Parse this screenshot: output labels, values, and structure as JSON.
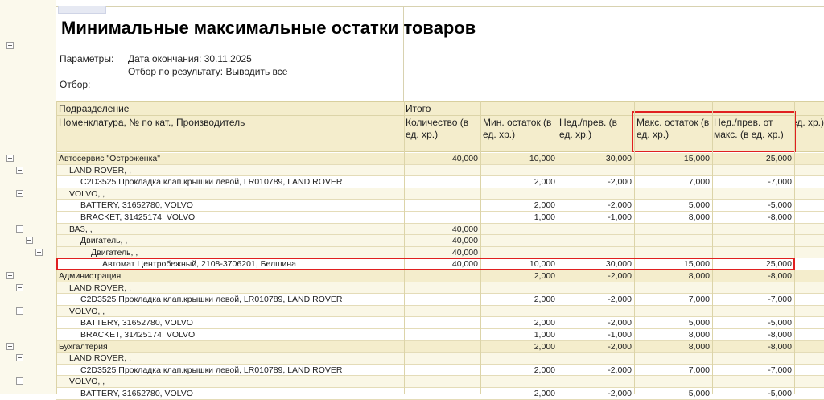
{
  "report": {
    "title": "Минимальные максимальные остатки товаров",
    "params_label": "Параметры:",
    "param1": "Дата окончания: 30.11.2025",
    "param2": "Отбор по результату: Выводить все",
    "filter_label": "Отбор:"
  },
  "header": {
    "group": "Подразделение",
    "item": "Номенклатура, № по кат., Производитель",
    "total": "Итого",
    "columns": [
      "Количество (в ед. хр.)",
      "Мин. остаток (в ед. хр.)",
      "Нед./прев. (в ед. хр.)",
      "Макс. остаток (в ед. хр.)",
      "Нед./прев. от макс. (в ед. хр.)",
      "Резерв (в ед. хр.)"
    ]
  },
  "highlight_color": "#e02020",
  "rows": [
    {
      "level": 0,
      "indent": 0,
      "name": "Автосервис \"Остроженка\"",
      "v": [
        "40,000",
        "10,000",
        "30,000",
        "15,000",
        "25,000"
      ]
    },
    {
      "level": 1,
      "indent": 1,
      "name": "LAND ROVER, ,",
      "v": [
        "",
        "",
        "",
        "",
        ""
      ]
    },
    {
      "level": 2,
      "indent": 2,
      "name": "C2D3525 Прокладка клап.крышки левой, LR010789, LAND ROVER",
      "v": [
        "",
        "2,000",
        "-2,000",
        "7,000",
        "-7,000"
      ]
    },
    {
      "level": 1,
      "indent": 1,
      "name": "VOLVO, ,",
      "v": [
        "",
        "",
        "",
        "",
        ""
      ]
    },
    {
      "level": 2,
      "indent": 2,
      "name": "BATTERY, 31652780, VOLVO",
      "v": [
        "",
        "2,000",
        "-2,000",
        "5,000",
        "-5,000"
      ]
    },
    {
      "level": 2,
      "indent": 2,
      "name": "BRACKET, 31425174, VOLVO",
      "v": [
        "",
        "1,000",
        "-1,000",
        "8,000",
        "-8,000"
      ]
    },
    {
      "level": 1,
      "indent": 1,
      "name": "ВАЗ, ,",
      "v": [
        "40,000",
        "",
        "",
        "",
        ""
      ]
    },
    {
      "level": 1,
      "indent": 2,
      "name": "Двигатель, ,",
      "v": [
        "40,000",
        "",
        "",
        "",
        ""
      ]
    },
    {
      "level": 1,
      "indent": 3,
      "name": "Двигатель, ,",
      "v": [
        "40,000",
        "",
        "",
        "",
        ""
      ]
    },
    {
      "level": 2,
      "indent": 4,
      "name": "Автомат Центробежный, 2108-3706201, Белшина",
      "v": [
        "40,000",
        "10,000",
        "30,000",
        "15,000",
        "25,000"
      ],
      "highlighted": true
    },
    {
      "level": 0,
      "indent": 0,
      "name": "Администрация",
      "v": [
        "",
        "2,000",
        "-2,000",
        "8,000",
        "-8,000"
      ]
    },
    {
      "level": 1,
      "indent": 1,
      "name": "LAND ROVER, ,",
      "v": [
        "",
        "",
        "",
        "",
        ""
      ]
    },
    {
      "level": 2,
      "indent": 2,
      "name": "C2D3525 Прокладка клап.крышки левой, LR010789, LAND ROVER",
      "v": [
        "",
        "2,000",
        "-2,000",
        "7,000",
        "-7,000"
      ]
    },
    {
      "level": 1,
      "indent": 1,
      "name": "VOLVO, ,",
      "v": [
        "",
        "",
        "",
        "",
        ""
      ]
    },
    {
      "level": 2,
      "indent": 2,
      "name": "BATTERY, 31652780, VOLVO",
      "v": [
        "",
        "2,000",
        "-2,000",
        "5,000",
        "-5,000"
      ]
    },
    {
      "level": 2,
      "indent": 2,
      "name": "BRACKET, 31425174, VOLVO",
      "v": [
        "",
        "1,000",
        "-1,000",
        "8,000",
        "-8,000"
      ]
    },
    {
      "level": 0,
      "indent": 0,
      "name": "Бухгалтерия",
      "v": [
        "",
        "2,000",
        "-2,000",
        "8,000",
        "-8,000"
      ]
    },
    {
      "level": 1,
      "indent": 1,
      "name": "LAND ROVER, ,",
      "v": [
        "",
        "",
        "",
        "",
        ""
      ]
    },
    {
      "level": 2,
      "indent": 2,
      "name": "C2D3525 Прокладка клап.крышки левой, LR010789, LAND ROVER",
      "v": [
        "",
        "2,000",
        "-2,000",
        "7,000",
        "-7,000"
      ]
    },
    {
      "level": 1,
      "indent": 1,
      "name": "VOLVO, ,",
      "v": [
        "",
        "",
        "",
        "",
        ""
      ]
    },
    {
      "level": 2,
      "indent": 2,
      "name": "BATTERY, 31652780, VOLVO",
      "v": [
        "",
        "2,000",
        "-2,000",
        "5,000",
        "-5,000"
      ]
    }
  ]
}
